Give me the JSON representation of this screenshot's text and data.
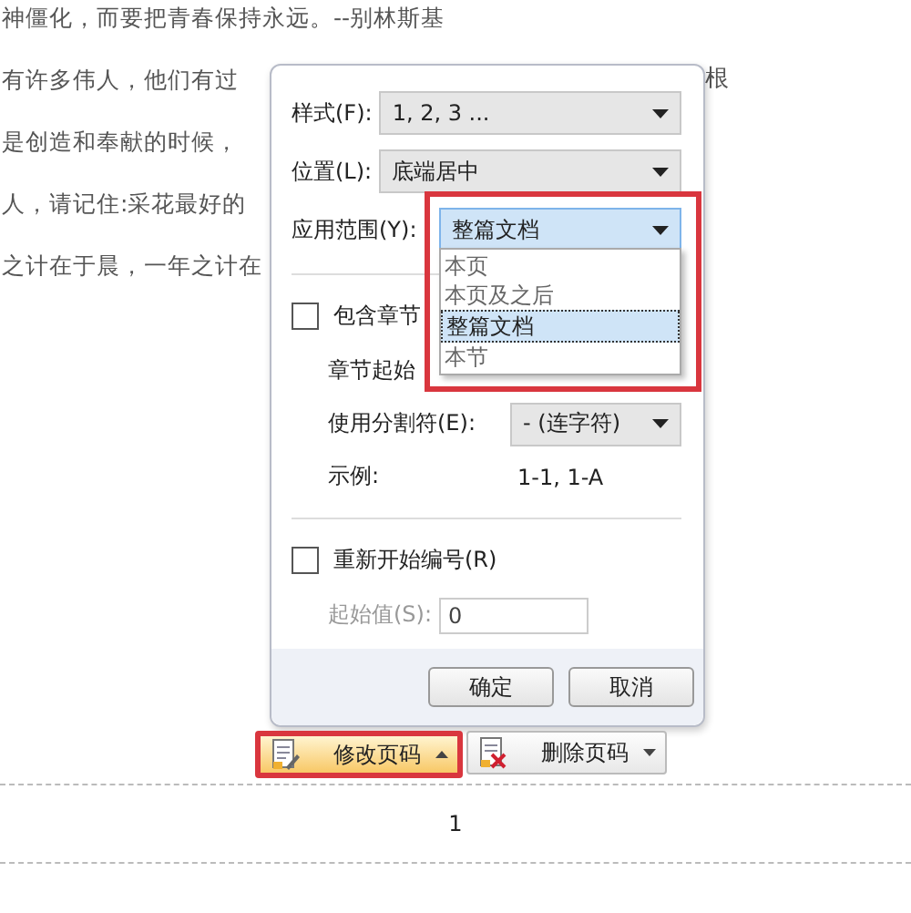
{
  "document": {
    "lines": [
      "神僵化，而要把青春保持永远。--别林斯基",
      "有许多伟人，他们有过",
      "是创造和奉献的时候，",
      "人，请记住:采花最好的",
      "之计在于晨，一年之计在"
    ],
    "right_fragment": "根",
    "page_number": "1"
  },
  "dialog": {
    "selects": [
      {
        "label": "样式(F):",
        "value": "1, 2, 3 ..."
      },
      {
        "label": "位置(L):",
        "value": "底端居中"
      }
    ],
    "scope": {
      "label": "应用范围(Y):",
      "value": "整篇文档",
      "highlighted": true,
      "options": [
        {
          "label": "本页",
          "selected": false
        },
        {
          "label": "本页及之后",
          "selected": false
        },
        {
          "label": "整篇文档",
          "selected": true
        },
        {
          "label": "本节",
          "selected": false
        }
      ]
    },
    "include_chapter": {
      "label": "包含章节",
      "checked": false
    },
    "chapter_style_label": "章节起始",
    "separator": {
      "label": "使用分割符(E):",
      "value": "-    (连字符)"
    },
    "example": {
      "label": "示例:",
      "value": "1-1, 1-A"
    },
    "restart": {
      "label": "重新开始编号(R)",
      "checked": false
    },
    "start_value": {
      "label": "起始值(S):",
      "value": "0",
      "disabled": true
    },
    "buttons": [
      "确定",
      "取消"
    ]
  },
  "toolbar": [
    {
      "label": "修改页码",
      "highlighted": true,
      "kind": "edit"
    },
    {
      "label": "删除页码",
      "highlighted": false,
      "kind": "delete"
    }
  ]
}
